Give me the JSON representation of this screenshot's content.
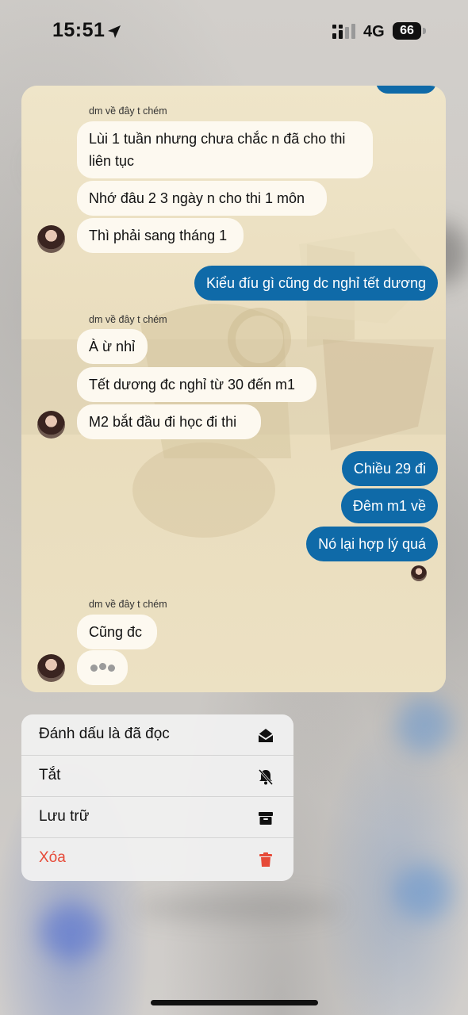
{
  "status_bar": {
    "time": "15:51",
    "network": "4G",
    "battery": "66"
  },
  "chat": {
    "messages": [
      {
        "id": 1,
        "group_label": "dm về đây t chém",
        "direction": "in",
        "lines": [
          "Lùi 1 tuần nhưng chưa chắc n đã cho thi",
          "liên tục"
        ]
      },
      {
        "id": 2,
        "direction": "in",
        "text": "Nhớ đâu 2 3 ngày n cho thi 1 môn"
      },
      {
        "id": 3,
        "direction": "in",
        "text": "Thì phải sang tháng 1"
      },
      {
        "id": 4,
        "direction": "out",
        "text": "Kiểu đíu gì cũng dc nghỉ tết dương"
      },
      {
        "id": 5,
        "group_label": "dm về đây t chém",
        "direction": "in",
        "text": "À ừ nhỉ"
      },
      {
        "id": 6,
        "direction": "in",
        "text": "Tết dương đc nghỉ từ 30 đến m1"
      },
      {
        "id": 7,
        "direction": "in",
        "text": "M2 bắt đầu đi học đi thi"
      },
      {
        "id": 8,
        "direction": "out",
        "text": "Chiều 29 đi"
      },
      {
        "id": 9,
        "direction": "out",
        "text": "Đêm m1 về"
      },
      {
        "id": 10,
        "direction": "out",
        "text": "Nó lại hợp lý quá"
      },
      {
        "id": 11,
        "group_label": "dm về đây t chém",
        "direction": "in",
        "text": "Cũng đc"
      }
    ]
  },
  "context_menu": {
    "items": [
      {
        "label": "Đánh dấu là đã đọc",
        "icon": "envelope-open-icon"
      },
      {
        "label": "Tắt",
        "icon": "bell-slash-icon"
      },
      {
        "label": "Lưu trữ",
        "icon": "archive-box-icon"
      },
      {
        "label": "Xóa",
        "icon": "trash-icon",
        "color": "#e64a38"
      }
    ]
  },
  "colors": {
    "outgoing_bubble": "#0f6aa8",
    "incoming_bubble": "#fdf9f0",
    "destructive": "#e64a38"
  }
}
